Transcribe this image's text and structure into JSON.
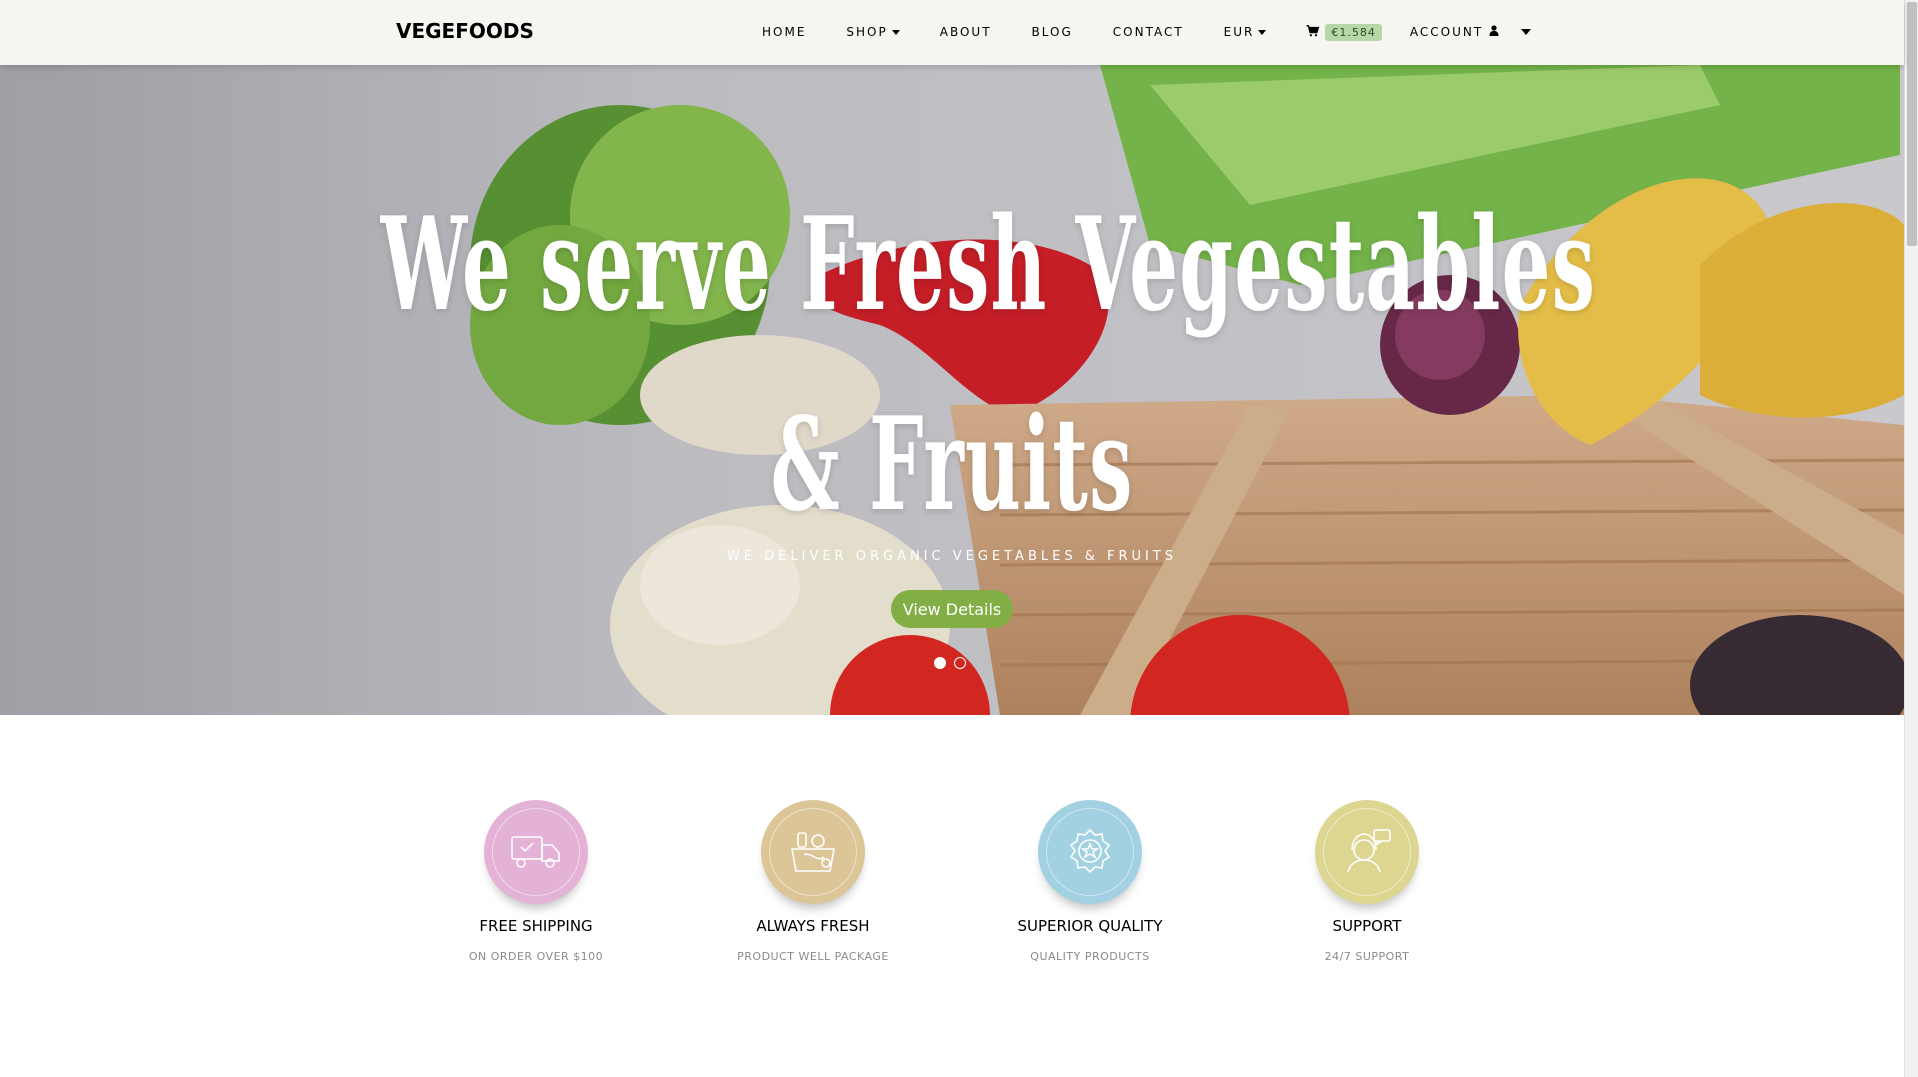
{
  "brand": "VEGEFOODS",
  "nav": {
    "home": "HOME",
    "shop": "SHOP",
    "about": "ABOUT",
    "blog": "BLOG",
    "contact": "CONTACT",
    "currency": "EUR",
    "cart_total": "€1.584",
    "account": "ACCOUNT"
  },
  "hero": {
    "title_line1": "We serve Fresh Vegestables",
    "title_line2": "& Fruits",
    "subtitle": "WE DELIVER ORGANIC VEGETABLES & FRUITS",
    "cta": "View Details",
    "slides_total": 2,
    "active_slide": 1
  },
  "services": [
    {
      "title": "FREE SHIPPING",
      "subtitle": "ON ORDER OVER $100",
      "icon": "delivery-truck-icon",
      "color": "#e4b2d6"
    },
    {
      "title": "ALWAYS FRESH",
      "subtitle": "PRODUCT WELL PACKAGE",
      "icon": "grocery-basket-icon",
      "color": "#dcc698"
    },
    {
      "title": "SUPERIOR QUALITY",
      "subtitle": "QUALITY PRODUCTS",
      "icon": "quality-award-icon",
      "color": "#a2d1e1"
    },
    {
      "title": "SUPPORT",
      "subtitle": "24/7 SUPPORT",
      "icon": "customer-support-icon",
      "color": "#dcd691"
    }
  ],
  "colors": {
    "accent": "#82ae46",
    "navbar_bg": "#f6f5f1",
    "cart_badge_bg": "#b6d8a6"
  }
}
